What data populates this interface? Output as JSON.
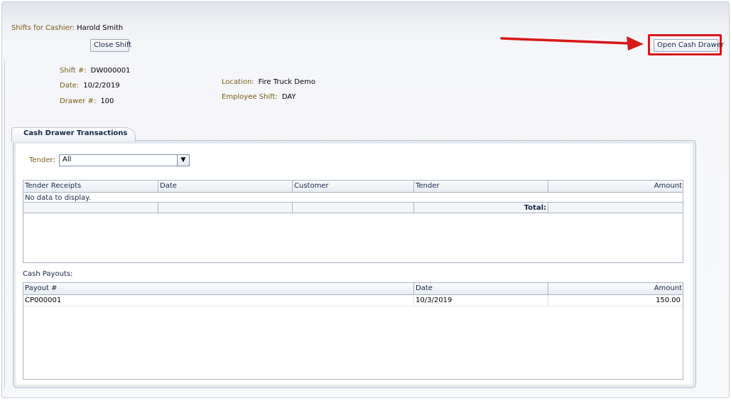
{
  "header": {
    "cashier_label": "Shifts for Cashier:",
    "cashier_name": "Harold Smith",
    "close_shift_label": "Close Shift",
    "open_cash_drawer_label": "Open Cash Drawer"
  },
  "shift": {
    "shift_label": "Shift #:",
    "shift_value": "DW000001",
    "date_label": "Date:",
    "date_value": "10/2/2019",
    "drawer_label": "Drawer #:",
    "drawer_value": "100",
    "location_label": "Location:",
    "location_value": "Fire Truck Demo",
    "employee_shift_label": "Employee Shift:",
    "employee_shift_value": "DAY"
  },
  "tab": {
    "label": "Cash Drawer Transactions"
  },
  "tender_filter": {
    "label": "Tender:",
    "selected": "All"
  },
  "receipts_table": {
    "columns": [
      "Tender Receipts",
      "Date",
      "Customer",
      "Tender",
      "Amount"
    ],
    "empty_text": "No data to display.",
    "total_label": "Total:"
  },
  "payouts": {
    "section_label": "Cash Payouts:",
    "columns": [
      "Payout #",
      "Date",
      "Amount"
    ],
    "rows": [
      {
        "payout": "CP000001",
        "date": "10/3/2019",
        "amount": "150.00"
      }
    ]
  },
  "colors": {
    "label_brown": "#7a5a10",
    "header_navy": "#142646",
    "highlight_red": "#d81818"
  }
}
